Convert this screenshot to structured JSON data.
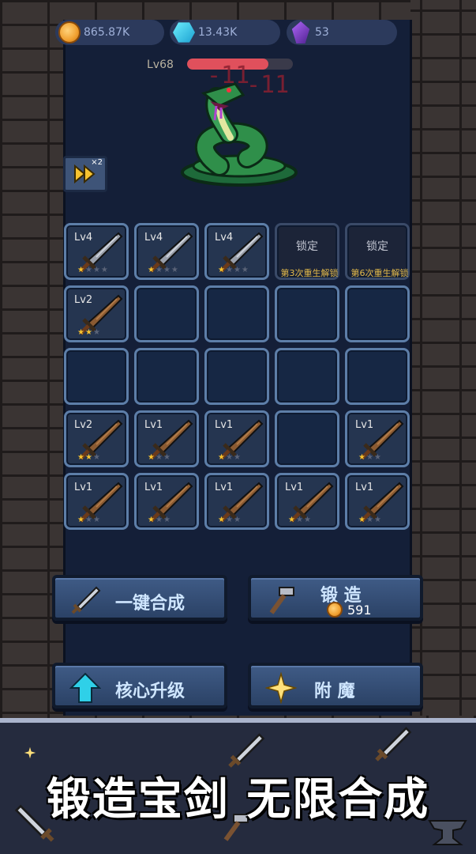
{
  "currencies": {
    "gold": "865.87K",
    "gems": "13.43K",
    "crystals": "53"
  },
  "boss": {
    "level": "Lv68",
    "hp_fraction": 0.77,
    "damage_numbers": [
      "-11",
      "-11"
    ]
  },
  "speed_button": {
    "multiplier": "×2"
  },
  "grid": {
    "slots": [
      {
        "state": "sword",
        "level": "Lv4",
        "stars": 1,
        "max_stars": 4,
        "material": "iron"
      },
      {
        "state": "sword",
        "level": "Lv4",
        "stars": 1,
        "max_stars": 4,
        "material": "iron"
      },
      {
        "state": "sword",
        "level": "Lv4",
        "stars": 1,
        "max_stars": 4,
        "material": "iron"
      },
      {
        "state": "locked",
        "title": "锁定",
        "desc": "第3次重生解锁"
      },
      {
        "state": "locked",
        "title": "锁定",
        "desc": "第6次重生解锁"
      },
      {
        "state": "sword",
        "level": "Lv2",
        "stars": 2,
        "max_stars": 3,
        "material": "wood"
      },
      {
        "state": "empty"
      },
      {
        "state": "empty"
      },
      {
        "state": "empty"
      },
      {
        "state": "empty"
      },
      {
        "state": "empty"
      },
      {
        "state": "empty"
      },
      {
        "state": "empty"
      },
      {
        "state": "empty"
      },
      {
        "state": "empty"
      },
      {
        "state": "sword",
        "level": "Lv2",
        "stars": 2,
        "max_stars": 3,
        "material": "wood"
      },
      {
        "state": "sword",
        "level": "Lv1",
        "stars": 1,
        "max_stars": 3,
        "material": "wood"
      },
      {
        "state": "sword",
        "level": "Lv1",
        "stars": 1,
        "max_stars": 3,
        "material": "wood"
      },
      {
        "state": "empty"
      },
      {
        "state": "sword",
        "level": "Lv1",
        "stars": 1,
        "max_stars": 3,
        "material": "wood"
      },
      {
        "state": "sword",
        "level": "Lv1",
        "stars": 1,
        "max_stars": 3,
        "material": "wood"
      },
      {
        "state": "sword",
        "level": "Lv1",
        "stars": 1,
        "max_stars": 3,
        "material": "wood"
      },
      {
        "state": "sword",
        "level": "Lv1",
        "stars": 1,
        "max_stars": 3,
        "material": "wood"
      },
      {
        "state": "sword",
        "level": "Lv1",
        "stars": 1,
        "max_stars": 3,
        "material": "wood"
      },
      {
        "state": "sword",
        "level": "Lv1",
        "stars": 1,
        "max_stars": 3,
        "material": "wood"
      }
    ]
  },
  "buttons": {
    "merge_all": "一键合成",
    "forge": "锻 造",
    "forge_cost": "591",
    "core_upgrade": "核心升级",
    "enchant": "附  魔"
  },
  "banner": {
    "slogan": "锻造宝剑  无限合成"
  },
  "colors": {
    "accent_gold": "#f7c330",
    "hp_red": "#e0505c",
    "slot_border": "#5d7ea8"
  },
  "icons": [
    "coin-icon",
    "gem-icon",
    "crystal-icon",
    "fast-forward-icon",
    "sword-icon",
    "hammer-icon",
    "arrow-up-icon",
    "sparkle-icon"
  ]
}
